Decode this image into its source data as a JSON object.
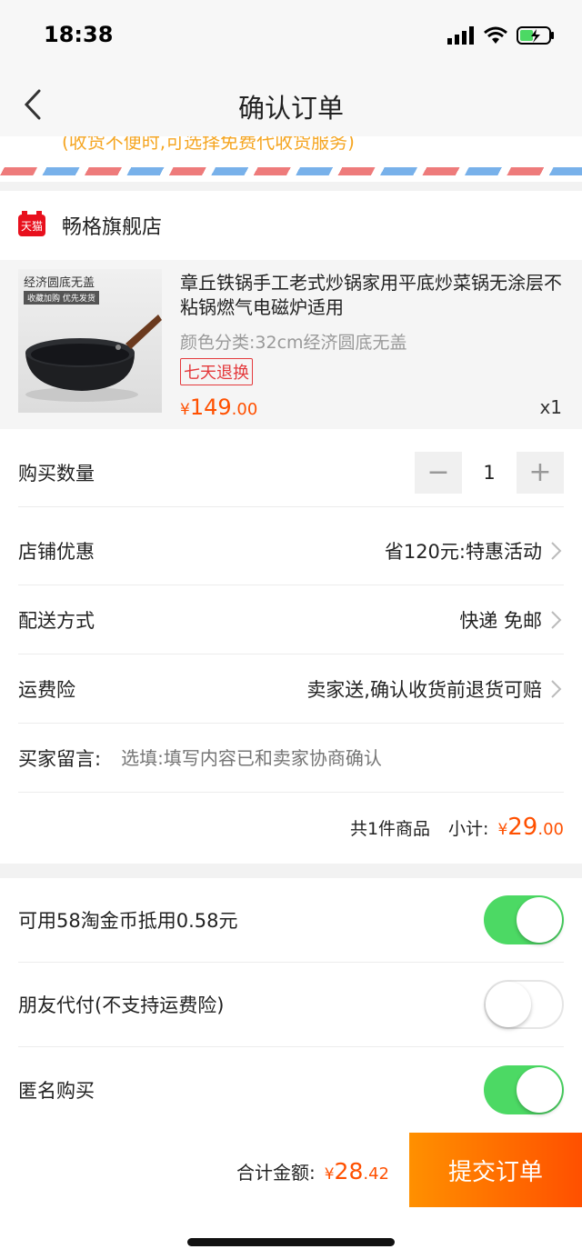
{
  "status": {
    "time": "18:38"
  },
  "nav": {
    "title": "确认订单"
  },
  "address": {
    "hint": "(收货不便时,可选择免费代收货服务)"
  },
  "shop": {
    "icon_text": "天猫",
    "name": "畅格旗舰店"
  },
  "product": {
    "image_caption": "经济圆底无盖",
    "image_sub": "收藏加购 优先发货",
    "title": "章丘铁锅手工老式炒锅家用平底炒菜锅无涂层不粘锅燃气电磁炉适用",
    "spec": "颜色分类:32cm经济圆底无盖",
    "badge": "七天退换",
    "price_currency": "¥",
    "price_int": "149",
    "price_dec": ".00",
    "qty": "x1"
  },
  "rows": {
    "quantity_label": "购买数量",
    "quantity_value": "1",
    "minus": "−",
    "plus": "+",
    "discount_label": "店铺优惠",
    "discount_value": "省120元:特惠活动",
    "shipping_label": "配送方式",
    "shipping_value": "快递 免邮",
    "insurance_label": "运费险",
    "insurance_value": "卖家送,确认收货前退货可赔",
    "note_label": "买家留言:",
    "note_placeholder": "选填:填写内容已和卖家协商确认",
    "subtotal_count": "共1件商品",
    "subtotal_label": "小计:",
    "subtotal_currency": "¥",
    "subtotal_int": "29",
    "subtotal_dec": ".00"
  },
  "options": [
    {
      "label": "可用58淘金币抵用0.58元",
      "on": true
    },
    {
      "label": "朋友代付(不支持运费险)",
      "on": false
    },
    {
      "label": "匿名购买",
      "on": true
    }
  ],
  "footer": {
    "total_label": "合计金额:",
    "total_currency": "¥",
    "total_int": "28",
    "total_dec": ".42",
    "submit_label": "提交订单"
  },
  "colors": {
    "accent": "#ff5000",
    "toggle_on": "#4cd964",
    "tmall_red": "#e8101d"
  }
}
